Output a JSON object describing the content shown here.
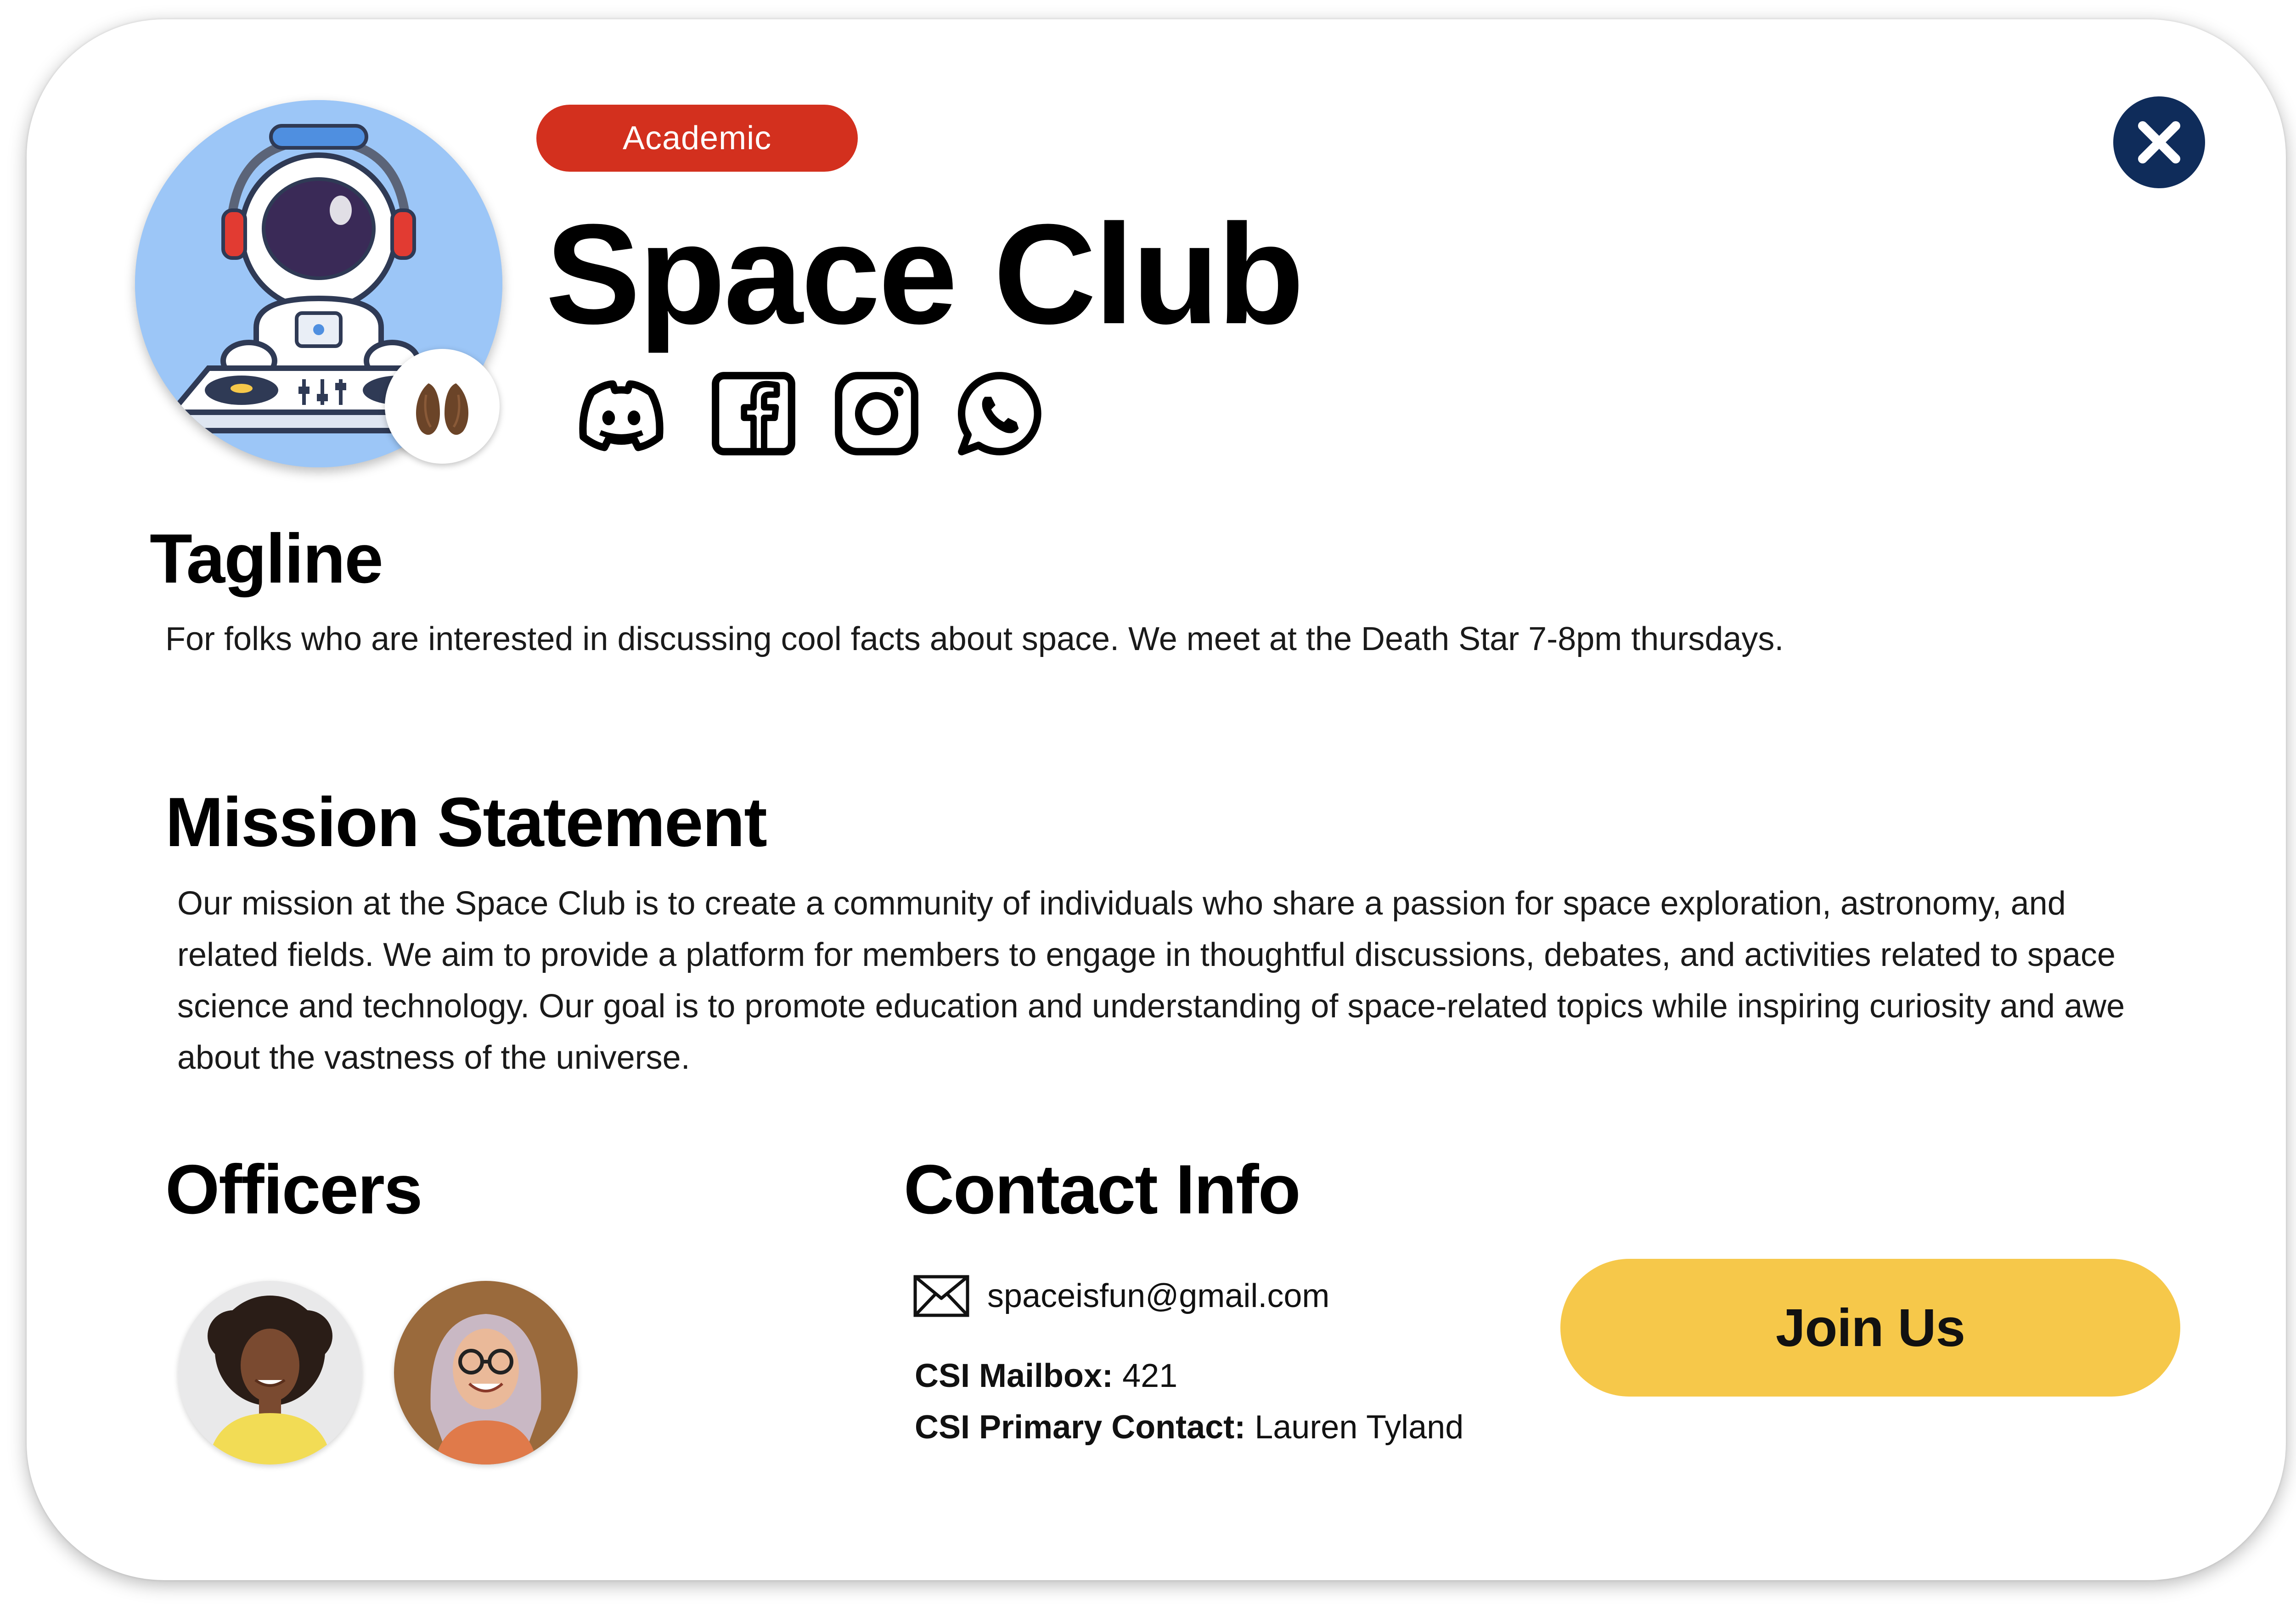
{
  "club": {
    "category": "Academic",
    "name": "Space Club",
    "avatar_icon": "astronaut-dj-icon",
    "badge_icon": "almond-icon"
  },
  "social": [
    {
      "name": "Discord",
      "icon": "discord-icon"
    },
    {
      "name": "Facebook",
      "icon": "facebook-icon"
    },
    {
      "name": "Instagram",
      "icon": "instagram-icon"
    },
    {
      "name": "WhatsApp",
      "icon": "whatsapp-icon"
    }
  ],
  "tagline": {
    "heading": "Tagline",
    "text": "For folks who are interested in discussing cool facts about space. We meet at the Death Star 7-8pm thursdays."
  },
  "mission": {
    "heading": "Mission Statement",
    "text": "Our mission at the Space Club is to create a community of individuals who share a passion for space exploration, astronomy, and related fields. We aim to provide a platform for members to engage in thoughtful discussions, debates, and activities related to space science and technology. Our goal is to promote education and understanding of space-related topics while inspiring curiosity and awe about the vastness of the universe."
  },
  "officers": {
    "heading": "Officers"
  },
  "contact": {
    "heading": "Contact Info",
    "email": "spaceisfun@gmail.com",
    "mailbox_label": "CSI Mailbox:",
    "mailbox_value": "421",
    "primary_label": "CSI Primary Contact:",
    "primary_value": "Lauren Tyland"
  },
  "actions": {
    "join_label": "Join Us",
    "close_icon": "close-icon"
  },
  "colors": {
    "category_pill": "#d3301e",
    "close_button": "#0f2c5a",
    "join_button": "#f6c84a",
    "avatar_bg": "#9cc6f7"
  }
}
